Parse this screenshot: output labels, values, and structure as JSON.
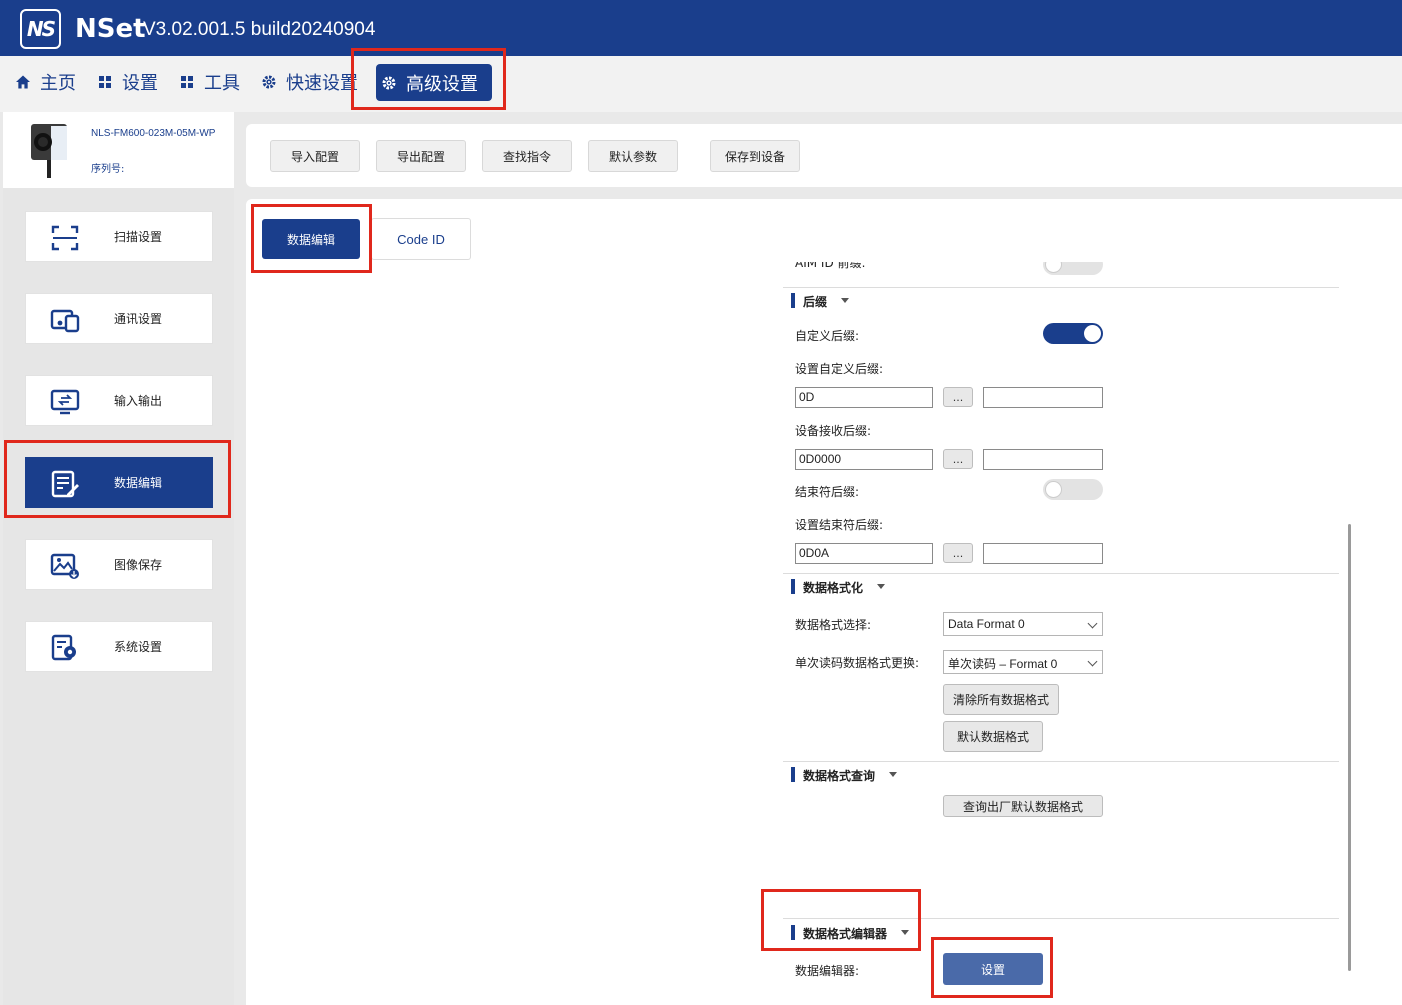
{
  "app": {
    "logo_text": "NS",
    "name": "NSet",
    "version": "V3.02.001.5 build20240904"
  },
  "menu": {
    "items": [
      {
        "label": "主页",
        "icon": "home-icon"
      },
      {
        "label": "设置",
        "icon": "grid-icon"
      },
      {
        "label": "工具",
        "icon": "grid-icon"
      },
      {
        "label": "快速设置",
        "icon": "gear-icon"
      },
      {
        "label": "高级设置",
        "icon": "gear-icon"
      }
    ],
    "active_index": 4
  },
  "device": {
    "model": "NLS-FM600-023M-05M-WP",
    "serial_label": "序列号:"
  },
  "sidebar": {
    "items": [
      {
        "label": "扫描设置",
        "icon": "scan-frame-icon"
      },
      {
        "label": "通讯设置",
        "icon": "communication-icon"
      },
      {
        "label": "输入输出",
        "icon": "monitor-io-icon"
      },
      {
        "label": "数据编辑",
        "icon": "document-edit-icon"
      },
      {
        "label": "图像保存",
        "icon": "image-save-icon"
      },
      {
        "label": "系统设置",
        "icon": "system-settings-icon"
      }
    ],
    "active_index": 3
  },
  "toolbar": {
    "import": "导入配置",
    "export": "导出配置",
    "find": "查找指令",
    "default": "默认参数",
    "save": "保存到设备"
  },
  "tabs": {
    "data_edit": "数据编辑",
    "code_id": "Code ID"
  },
  "partial_label": "AIM ID 前缀:",
  "suffix": {
    "title": "后缀",
    "custom_suffix_label": "自定义后缀:",
    "custom_suffix_on": true,
    "set_custom_suffix_label": "设置自定义后缀:",
    "set_custom_suffix_value": "0D",
    "device_recv_suffix_label": "设备接收后缀:",
    "device_recv_suffix_value": "0D0000",
    "terminator_suffix_label": "结束符后缀:",
    "terminator_suffix_on": false,
    "set_terminator_suffix_label": "设置结束符后缀:",
    "set_terminator_suffix_value": "0D0A",
    "dots": "..."
  },
  "data_format": {
    "title": "数据格式化",
    "select_label": "数据格式选择:",
    "select_value": "Data Format 0",
    "single_read_label": "单次读码数据格式更换:",
    "single_read_value": "单次读码 – Format 0",
    "clear_all": "清除所有数据格式",
    "default_format": "默认数据格式"
  },
  "format_query": {
    "title": "数据格式查询",
    "query_button": "查询出厂默认数据格式"
  },
  "format_editor": {
    "title": "数据格式编辑器",
    "editor_label": "数据编辑器:",
    "set_button": "设置"
  },
  "colors": {
    "primary": "#1a3e8c",
    "highlight": "#e0281c",
    "set_button": "#4a6aa9"
  }
}
